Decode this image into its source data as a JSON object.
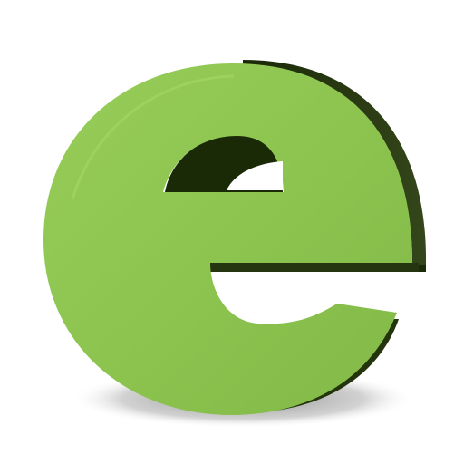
{
  "image": {
    "subject": "e-letter-icon",
    "letter": "e",
    "colors": {
      "background": "#ffffff",
      "face": "#8cc34f",
      "face_highlight": "#9ccf5c",
      "extrusion": "#2f3f16",
      "extrusion_dark": "#142006",
      "shadow": "#8a8a8a"
    }
  }
}
